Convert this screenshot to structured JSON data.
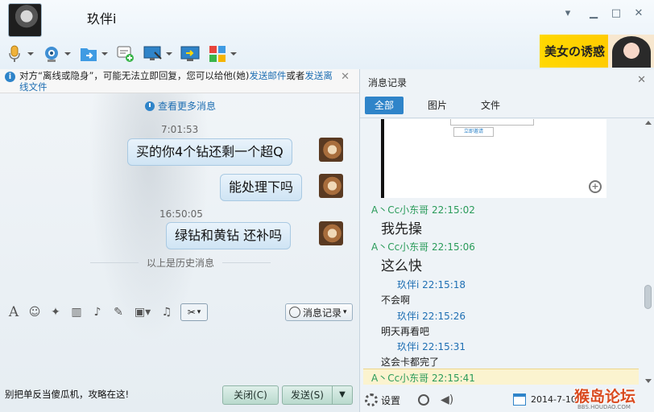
{
  "window": {
    "contact_name": "玖伴i",
    "controls": [
      "chevron-down",
      "minimize",
      "maximize",
      "close"
    ]
  },
  "toolbar": {
    "buttons": [
      {
        "icon": "microphone-icon"
      },
      {
        "icon": "webcam-icon"
      },
      {
        "icon": "file-transfer-icon"
      },
      {
        "icon": "add-chat-icon"
      },
      {
        "icon": "remote-desktop-icon"
      },
      {
        "icon": "screen-share-icon"
      },
      {
        "icon": "apps-grid-icon"
      }
    ]
  },
  "ad": {
    "text": "美女の诱惑"
  },
  "notice": {
    "prefix": "对方“离线或隐身”，可能无法立即回复，您可以给他(她)",
    "link1": "发送邮件",
    "middle": "或者",
    "link2": "发送离线文件"
  },
  "chat": {
    "more_messages": "查看更多消息",
    "messages": [
      {
        "time": "7:01:53",
        "text": "买的你4个钻还剩一个超Q"
      },
      {
        "time": "",
        "text": "能处理下吗"
      },
      {
        "time": "16:50:05",
        "text": "绿钻和黄钻  还补吗"
      }
    ],
    "history_divider": "以上是历史消息"
  },
  "input": {
    "history_button": "消息记录",
    "text": "别把单反当傻瓜机，攻略在这!",
    "close_button": "关闭(C)",
    "send_button": "发送(S)"
  },
  "record_panel": {
    "title": "消息记录",
    "tabs": [
      "全部",
      "图片",
      "文件"
    ],
    "image_preview_button": "立即邀请",
    "entries": [
      {
        "sender": "A丶Cc小东哥",
        "time": "22:15:02",
        "text": "我先操",
        "style": "green-big"
      },
      {
        "sender": "A丶Cc小东哥",
        "time": "22:15:06",
        "text": "这么快",
        "style": "green-big"
      },
      {
        "sender": "玖伴i",
        "time": "22:15:18",
        "text": "不会啊",
        "style": "blue"
      },
      {
        "sender": "玖伴i",
        "time": "22:15:26",
        "text": "明天再看吧",
        "style": "blue"
      },
      {
        "sender": "玖伴i",
        "time": "22:15:31",
        "text": "这会卡都完了",
        "style": "blue"
      },
      {
        "sender": "A丶Cc小东哥",
        "time": "22:15:41",
        "text": "",
        "style": "green"
      }
    ],
    "settings_label": "设置",
    "date": "2014-7-10"
  },
  "watermark": {
    "text": "猴岛论坛",
    "sub": "BBS.HOUDAO.COM"
  }
}
